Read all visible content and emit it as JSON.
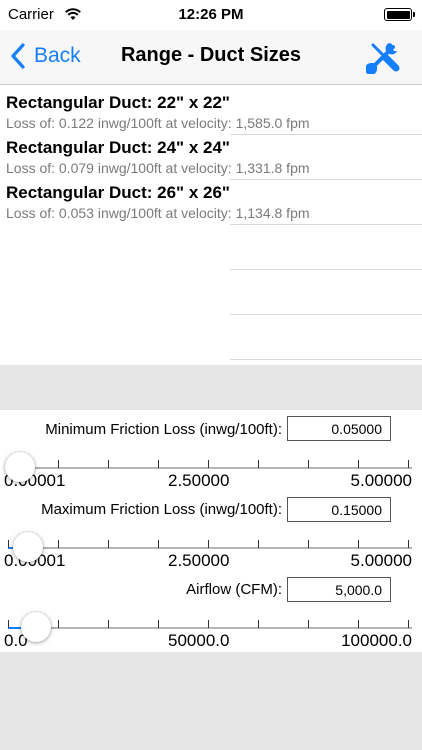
{
  "status_bar": {
    "carrier": "Carrier",
    "time": "12:26 PM"
  },
  "nav": {
    "back_label": "Back",
    "title": "Range - Duct Sizes"
  },
  "results": [
    {
      "heading": "Rectangular Duct: 22\" x 22\"",
      "detail": "Loss of: 0.122 inwg/100ft at velocity: 1,585.0 fpm"
    },
    {
      "heading": "Rectangular Duct: 24\" x 24\"",
      "detail": "Loss of: 0.079 inwg/100ft at velocity: 1,331.8 fpm"
    },
    {
      "heading": "Rectangular Duct: 26\" x 26\"",
      "detail": "Loss of: 0.053 inwg/100ft at velocity: 1,134.8 fpm"
    }
  ],
  "min_friction": {
    "label": "Minimum Friction Loss (inwg/100ft):",
    "value": "0.05000",
    "slider_fraction": 0.01,
    "tick_min": "0.00001",
    "tick_mid": "2.50000",
    "tick_max": "5.00000"
  },
  "max_friction": {
    "label": "Maximum Friction Loss (inwg/100ft):",
    "value": "0.15000",
    "slider_fraction": 0.03,
    "tick_min": "0.00001",
    "tick_mid": "2.50000",
    "tick_max": "5.00000"
  },
  "airflow": {
    "label": "Airflow (CFM):",
    "value": "5,000.0",
    "slider_fraction": 0.05,
    "tick_min": "0.0",
    "tick_mid": "50000.0",
    "tick_max": "100000.0"
  },
  "colors": {
    "accent": "#147efb",
    "background_gray": "#e6e6e6"
  },
  "icons": {
    "back": "chevron-left-icon",
    "tools": "wrench-screwdriver-icon",
    "wifi": "wifi-icon",
    "battery": "battery-icon"
  }
}
